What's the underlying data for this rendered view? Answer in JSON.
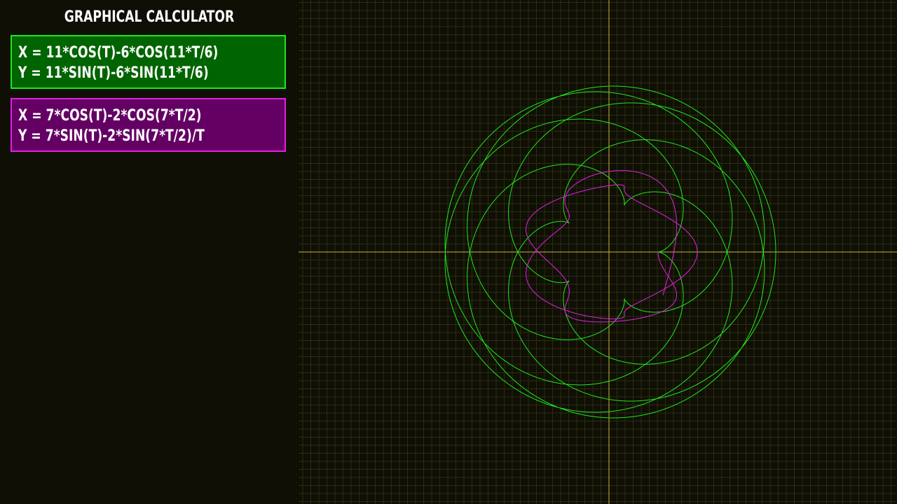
{
  "app": {
    "title": "GRAPHICAL CALCULATOR"
  },
  "equations": [
    {
      "x_expr": "X = 11*COS(T)-6*COS(11*T/6)",
      "y_expr": "Y = 11*SIN(T)-6*SIN(11*T/6)",
      "fill_color": "#006400",
      "border_color": "#1fe61f",
      "curve_color": "#1fe61f"
    },
    {
      "x_expr": "X = 7*COS(T)-2*COS(7*T/2)",
      "y_expr": "Y = 7*SIN(T)-2*SIN(7*T/2)/T",
      "fill_color": "#640064",
      "border_color": "#e61fe6",
      "curve_color": "#e61fe6"
    }
  ],
  "graph": {
    "background": "#0f0f05",
    "grid_color": "#2b2e10",
    "axis_color": "#c8b43c",
    "grid": true
  }
}
